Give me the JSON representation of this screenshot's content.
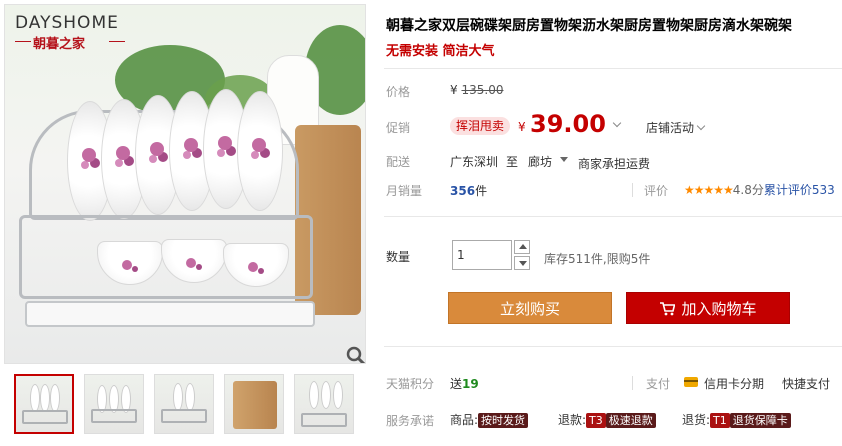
{
  "logo": {
    "brand_en": "DAYSHOME",
    "brand_cn": "朝暮之家"
  },
  "product": {
    "title": "朝暮之家双层碗碟架厨房置物架沥水架厨房置物架厨房滴水架碗架",
    "subtitle": "无需安装 简洁大气"
  },
  "price": {
    "label": "价格",
    "original_currency": "¥",
    "original": "135.00"
  },
  "promo": {
    "label": "促销",
    "badge": "挥泪甩卖",
    "currency": "¥",
    "price": "39.00",
    "store_activity": "店铺活动"
  },
  "shipping": {
    "label": "配送",
    "from": "广东深圳",
    "to_word": "至",
    "to": "廊坊",
    "note": "商家承担运费"
  },
  "sales": {
    "label": "月销量",
    "count": "356",
    "unit": "件",
    "rating_label": "评价",
    "stars": "★★★★★",
    "score": "4.8分",
    "review_text": "累计评价533"
  },
  "quantity": {
    "label": "数量",
    "value": "1",
    "stock_text": "库存511件,限购5件"
  },
  "buttons": {
    "buy_now": "立刻购买",
    "add_to_cart": "加入购物车"
  },
  "points": {
    "label": "天猫积分",
    "prefix": "送",
    "value": "19",
    "pay_label": "支付",
    "credit_installment": "信用卡分期",
    "quick_pay": "快捷支付"
  },
  "service": {
    "label": "服务承诺",
    "goods_prefix": "商品:",
    "goods_tag": "按时发货",
    "refund_prefix": "退款:",
    "refund_code": "T3",
    "refund_tag": "极速退款",
    "return_prefix": "退货:",
    "return_code": "T1",
    "return_tag": "退货保障卡"
  },
  "icons": {
    "zoom": "magnifier-icon",
    "cart": "cart-icon",
    "card": "credit-card-icon"
  },
  "colors": {
    "accent_red": "#c40000",
    "buy_orange": "#d98a3b",
    "sales_blue": "#2953a6",
    "star_orange": "#ff8a00"
  }
}
